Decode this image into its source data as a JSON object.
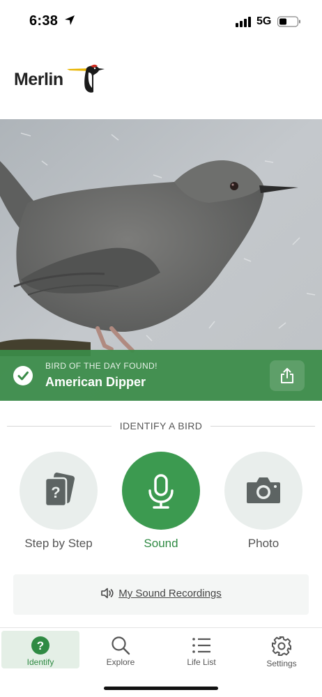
{
  "status_bar": {
    "time": "6:38",
    "network": "5G"
  },
  "app": {
    "logo_text": "Merlin"
  },
  "bird_of_day": {
    "heading": "BIRD OF THE DAY FOUND!",
    "name": "American Dipper"
  },
  "identify": {
    "title": "IDENTIFY A BIRD",
    "options": [
      {
        "label": "Step by Step",
        "icon": "cards-question-icon"
      },
      {
        "label": "Sound",
        "icon": "microphone-icon"
      },
      {
        "label": "Photo",
        "icon": "camera-icon"
      }
    ]
  },
  "recordings": {
    "label": "My Sound Recordings",
    "icon": "speaker-icon"
  },
  "tabs": [
    {
      "label": "Identify",
      "icon": "question-circle-icon"
    },
    {
      "label": "Explore",
      "icon": "search-icon"
    },
    {
      "label": "Life List",
      "icon": "list-icon"
    },
    {
      "label": "Settings",
      "icon": "gear-icon"
    }
  ],
  "colors": {
    "accent": "#3c9a50",
    "banner": "#3a8c48",
    "option_bg": "#e9eeec"
  }
}
